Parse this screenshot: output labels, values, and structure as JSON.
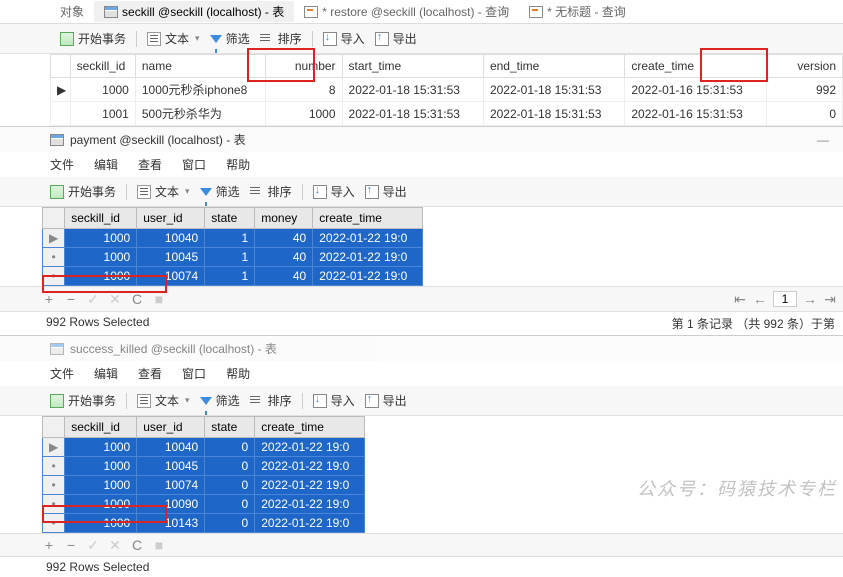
{
  "top_tabs": {
    "active_label": "对象",
    "tab1": "seckill @seckill (localhost) - 表",
    "tab2": "* restore @seckill (localhost) - 查询",
    "tab3": "* 无标题 - 查询"
  },
  "toolbar": {
    "begin_trans": "开始事务",
    "text": "文本",
    "filter": "筛选",
    "sort": "排序",
    "import": "导入",
    "export": "导出"
  },
  "seckill_table": {
    "cols": {
      "c1": "seckill_id",
      "c2": "name",
      "c3": "number",
      "c4": "start_time",
      "c5": "end_time",
      "c6": "create_time",
      "c7": "version"
    },
    "rows": [
      {
        "ptr": "▶",
        "id": "1000",
        "name": "1000元秒杀iphone8",
        "number": "8",
        "start": "2022-01-18 15:31:53",
        "end": "2022-01-18 15:31:53",
        "create": "2022-01-16 15:31:53",
        "version": "992"
      },
      {
        "ptr": "",
        "id": "1001",
        "name": "500元秒杀华为",
        "number": "1000",
        "start": "2022-01-18 15:31:53",
        "end": "2022-01-18 15:31:53",
        "create": "2022-01-16 15:31:53",
        "version": "0"
      }
    ]
  },
  "payment": {
    "title": "payment @seckill (localhost) - 表",
    "menu": {
      "file": "文件",
      "edit": "编辑",
      "view": "查看",
      "window": "窗口",
      "help": "帮助"
    },
    "cols": {
      "c1": "seckill_id",
      "c2": "user_id",
      "c3": "state",
      "c4": "money",
      "c5": "create_time"
    },
    "rows": [
      {
        "id": "1000",
        "uid": "10040",
        "state": "1",
        "money": "40",
        "ct": "2022-01-22 19:0"
      },
      {
        "id": "1000",
        "uid": "10045",
        "state": "1",
        "money": "40",
        "ct": "2022-01-22 19:0"
      },
      {
        "id": "1000",
        "uid": "10074",
        "state": "1",
        "money": "40",
        "ct": "2022-01-22 19:0"
      }
    ],
    "status_left": "992 Rows Selected",
    "status_right": "第 1 条记录 （共 992 条）于第",
    "page": "1"
  },
  "success_killed": {
    "title": "success_killed @seckill (localhost) - 表",
    "cols": {
      "c1": "seckill_id",
      "c2": "user_id",
      "c3": "state",
      "c4": "create_time"
    },
    "rows": [
      {
        "id": "1000",
        "uid": "10040",
        "state": "0",
        "ct": "2022-01-22 19:0"
      },
      {
        "id": "1000",
        "uid": "10045",
        "state": "0",
        "ct": "2022-01-22 19:0"
      },
      {
        "id": "1000",
        "uid": "10074",
        "state": "0",
        "ct": "2022-01-22 19:0"
      },
      {
        "id": "1000",
        "uid": "10090",
        "state": "0",
        "ct": "2022-01-22 19:0"
      },
      {
        "id": "1000",
        "uid": "10143",
        "state": "0",
        "ct": "2022-01-22 19:0"
      }
    ],
    "status_left": "992 Rows Selected"
  },
  "watermark": "公众号：码猿技术专栏"
}
